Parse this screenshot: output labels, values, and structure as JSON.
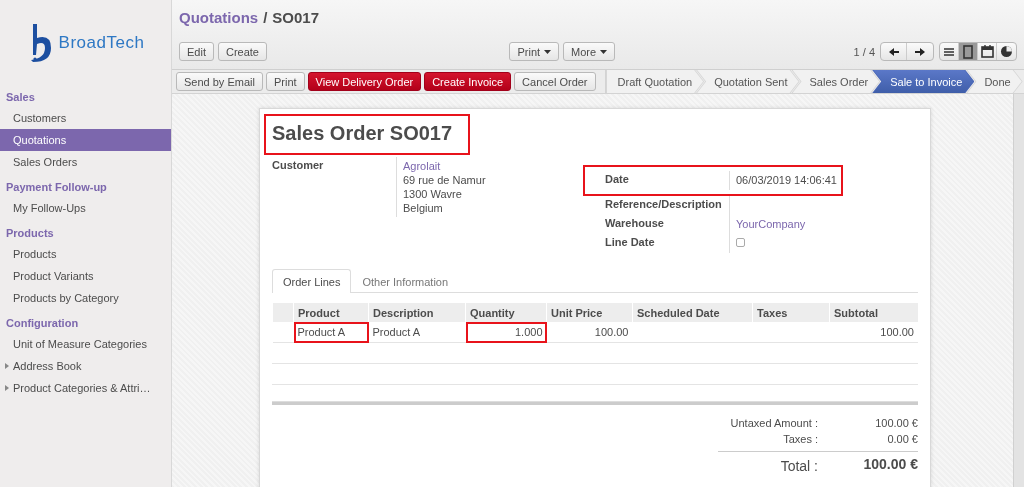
{
  "logo": {
    "text": "BroadTech"
  },
  "sidebar": {
    "sections": [
      {
        "title": "Sales",
        "items": [
          {
            "label": "Customers",
            "kind": "link",
            "selected": false
          },
          {
            "label": "Quotations",
            "kind": "link",
            "selected": true
          },
          {
            "label": "Sales Orders",
            "kind": "link",
            "selected": false
          }
        ]
      },
      {
        "title": "Payment Follow-up",
        "items": [
          {
            "label": "My Follow-Ups",
            "kind": "link",
            "selected": false
          }
        ]
      },
      {
        "title": "Products",
        "items": [
          {
            "label": "Products",
            "kind": "link",
            "selected": false
          },
          {
            "label": "Product Variants",
            "kind": "link",
            "selected": false
          },
          {
            "label": "Products by Category",
            "kind": "link",
            "selected": false
          }
        ]
      },
      {
        "title": "Configuration",
        "items": [
          {
            "label": "Unit of Measure Categories",
            "kind": "link",
            "selected": false
          },
          {
            "label": "Address Book",
            "kind": "folder",
            "selected": false
          },
          {
            "label": "Product Categories & Attri…",
            "kind": "folder",
            "selected": false
          }
        ]
      }
    ]
  },
  "header": {
    "breadcrumb": [
      {
        "label": "Quotations",
        "kind": "link"
      },
      {
        "label": "SO017",
        "kind": "current"
      }
    ],
    "breadcrumb_separator": "/",
    "buttons": [
      "Edit",
      "Create"
    ],
    "dropdowns": [
      "Print",
      "More"
    ],
    "pager": "1 / 4",
    "views": [
      {
        "kind": "list",
        "selected": false
      },
      {
        "kind": "form",
        "selected": true
      },
      {
        "kind": "calendar",
        "selected": false
      },
      {
        "kind": "graph",
        "selected": false
      }
    ]
  },
  "actions": [
    {
      "label": "Send by Email",
      "kind": "default"
    },
    {
      "label": "Print",
      "kind": "default"
    },
    {
      "label": "View Delivery Order",
      "kind": "primary"
    },
    {
      "label": "Create Invoice",
      "kind": "primary"
    },
    {
      "label": "Cancel Order",
      "kind": "default"
    }
  ],
  "stages": [
    {
      "label": "Draft Quotation",
      "selected": false
    },
    {
      "label": "Quotation Sent",
      "selected": false
    },
    {
      "label": "Sales Order",
      "selected": false
    },
    {
      "label": "Sale to Invoice",
      "selected": true
    },
    {
      "label": "Done",
      "selected": false
    }
  ],
  "sheet": {
    "title": "Sales Order SO017",
    "title_highlighted": true,
    "left_fields": [
      {
        "label": "Customer",
        "kind": "address",
        "value": "Agrolait",
        "lines": [
          "69 rue de Namur",
          "1300 Wavre",
          "Belgium"
        ],
        "highlighted": false
      }
    ],
    "right_fields": [
      {
        "label": "Date",
        "kind": "text",
        "value": "06/03/2019 14:06:41",
        "highlighted": true
      },
      {
        "label": "Reference/Description",
        "kind": "text",
        "highlighted": false
      },
      {
        "label": "Warehouse",
        "kind": "link",
        "value": "YourCompany",
        "highlighted": false
      },
      {
        "label": "Line Date",
        "kind": "checkbox",
        "checked": false,
        "highlighted": false
      }
    ],
    "tabs": [
      {
        "label": "Order Lines",
        "selected": true
      },
      {
        "label": "Other Information",
        "selected": false
      }
    ],
    "table": {
      "columns": [
        {
          "label": "Product",
          "kind": "text"
        },
        {
          "label": "Description",
          "kind": "text"
        },
        {
          "label": "Quantity",
          "kind": "number"
        },
        {
          "label": "Unit Price",
          "kind": "number"
        },
        {
          "label": "Scheduled Date",
          "kind": "text"
        },
        {
          "label": "Taxes",
          "kind": "text"
        },
        {
          "label": "Subtotal",
          "kind": "number"
        }
      ],
      "rows": [
        {
          "cells": [
            {
              "text": "Product A",
              "highlighted": true
            },
            {
              "text": "Product A",
              "highlighted": false
            },
            {
              "text": "1.000",
              "highlighted": true
            },
            {
              "text": "100.00",
              "highlighted": false
            },
            {
              "highlighted": false
            },
            {
              "highlighted": false
            },
            {
              "text": "100.00",
              "highlighted": false
            }
          ]
        }
      ]
    },
    "totals": [
      {
        "label": "Untaxed Amount :",
        "value": "100.00 €",
        "kind": "line"
      },
      {
        "label": "Taxes :",
        "value": "0.00 €",
        "kind": "line"
      },
      {
        "label": "Total :",
        "value": "100.00 €",
        "kind": "grand"
      }
    ]
  }
}
